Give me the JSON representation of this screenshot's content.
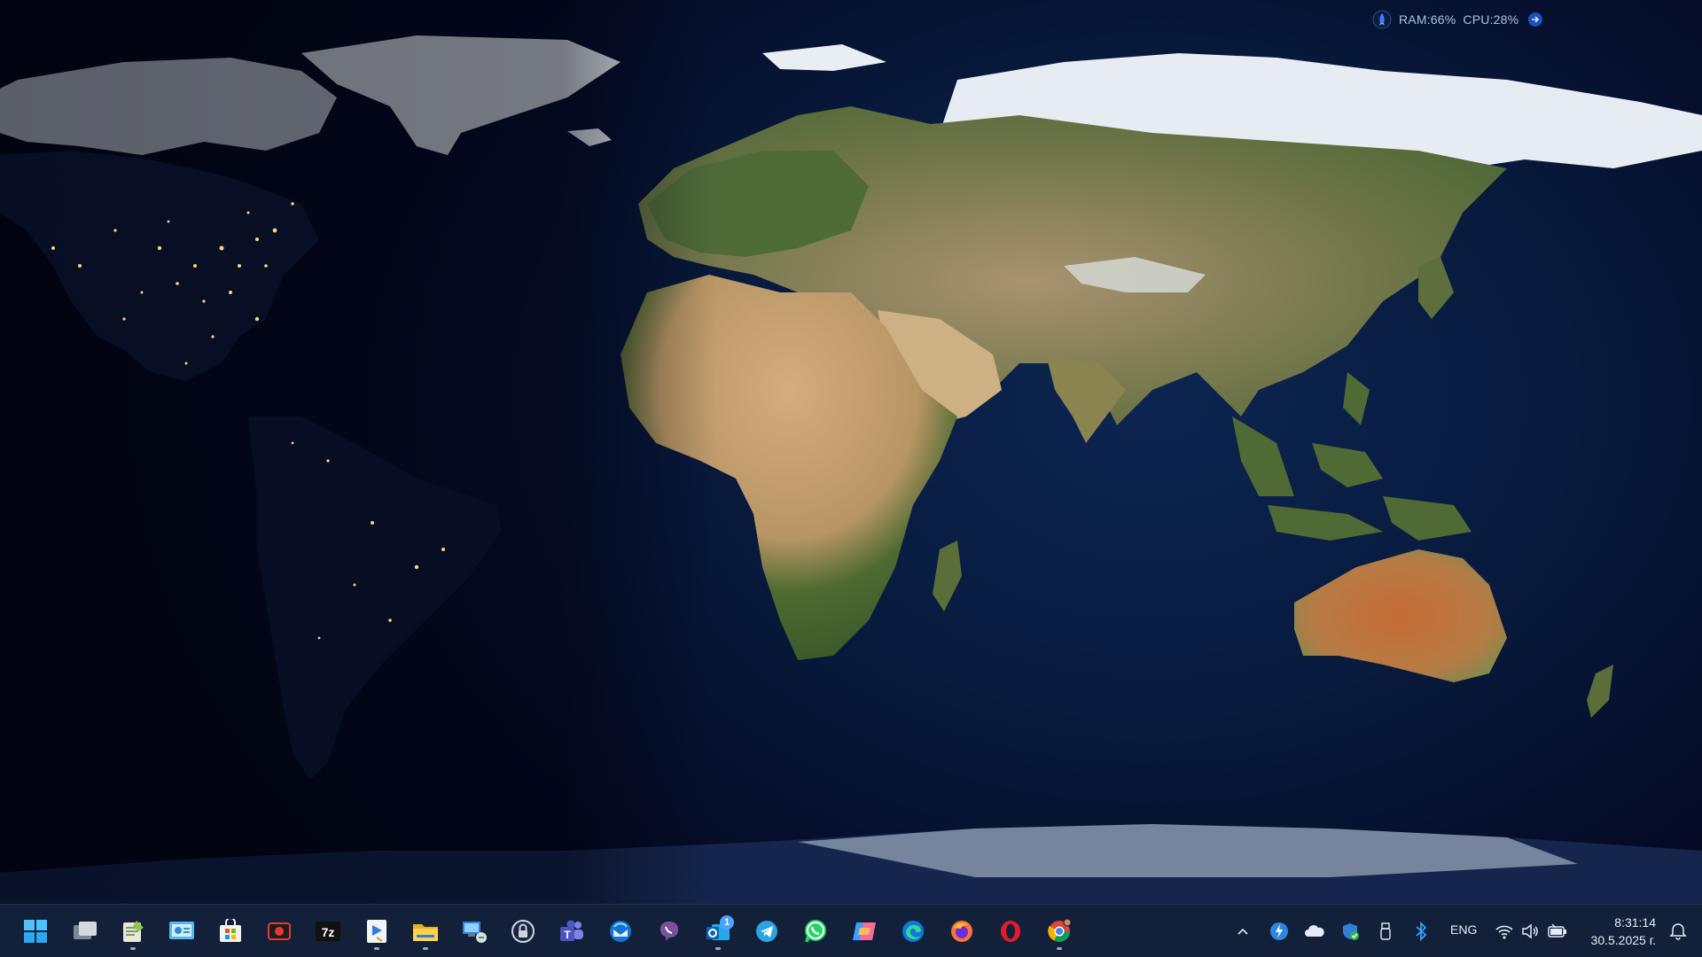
{
  "system_monitor": {
    "ram_label": "RAM:66%",
    "cpu_label": "CPU:28%",
    "icon": "rocket-icon",
    "expand_icon": "arrow-right-icon"
  },
  "taskbar": {
    "apps": [
      {
        "name": "start-button",
        "icon": "windows-start-icon",
        "running": false
      },
      {
        "name": "task-view-button",
        "icon": "task-view-icon",
        "running": false
      },
      {
        "name": "notepad-plus-button",
        "icon": "notepad-icon",
        "running": true
      },
      {
        "name": "control-panel-button",
        "icon": "control-panel-icon",
        "running": false
      },
      {
        "name": "microsoft-store-button",
        "icon": "store-icon",
        "running": false
      },
      {
        "name": "screen-recorder-button",
        "icon": "recorder-icon",
        "running": false
      },
      {
        "name": "7zip-button",
        "icon": "7zip-icon",
        "label": "7z",
        "running": false
      },
      {
        "name": "winscp-button",
        "icon": "transfer-icon",
        "running": true
      },
      {
        "name": "file-explorer-button",
        "icon": "folder-icon",
        "running": true
      },
      {
        "name": "remote-desktop-button",
        "icon": "remote-desktop-icon",
        "running": false
      },
      {
        "name": "password-manager-button",
        "icon": "lock-icon",
        "running": false
      },
      {
        "name": "teams-button",
        "icon": "teams-icon",
        "running": false
      },
      {
        "name": "thunderbird-button",
        "icon": "thunderbird-icon",
        "running": false
      },
      {
        "name": "viber-button",
        "icon": "viber-icon",
        "running": false
      },
      {
        "name": "outlook-button",
        "icon": "mail-icon",
        "running": true,
        "badge": "1"
      },
      {
        "name": "telegram-button",
        "icon": "telegram-icon",
        "running": false
      },
      {
        "name": "whatsapp-button",
        "icon": "whatsapp-icon",
        "running": false
      },
      {
        "name": "copilot-button",
        "icon": "copilot-icon",
        "running": false
      },
      {
        "name": "edge-button",
        "icon": "edge-icon",
        "running": false
      },
      {
        "name": "firefox-button",
        "icon": "firefox-icon",
        "running": false
      },
      {
        "name": "opera-button",
        "icon": "opera-icon",
        "running": false
      },
      {
        "name": "chrome-button",
        "icon": "chrome-icon",
        "running": true
      }
    ]
  },
  "tray": {
    "icons": [
      "chevron-up-icon",
      "lightning-icon",
      "cloud-icon",
      "shield-icon",
      "usb-icon",
      "bluetooth-icon"
    ],
    "language": "ENG",
    "status_icons": [
      "wifi-icon",
      "volume-icon",
      "battery-icon"
    ],
    "time": "8:31:14",
    "date": "30.5.2025 г.",
    "notification_icon": "bell-icon"
  },
  "colors": {
    "taskbar_bg": "#13203a",
    "accent": "#4aa3ff",
    "ocean_dark": "#040a24",
    "ocean_day": "#0c2550",
    "ice": "#e8edf2",
    "desert": "#c9a679",
    "forest": "#4f6a33",
    "city_lights": "#ffd27a"
  }
}
